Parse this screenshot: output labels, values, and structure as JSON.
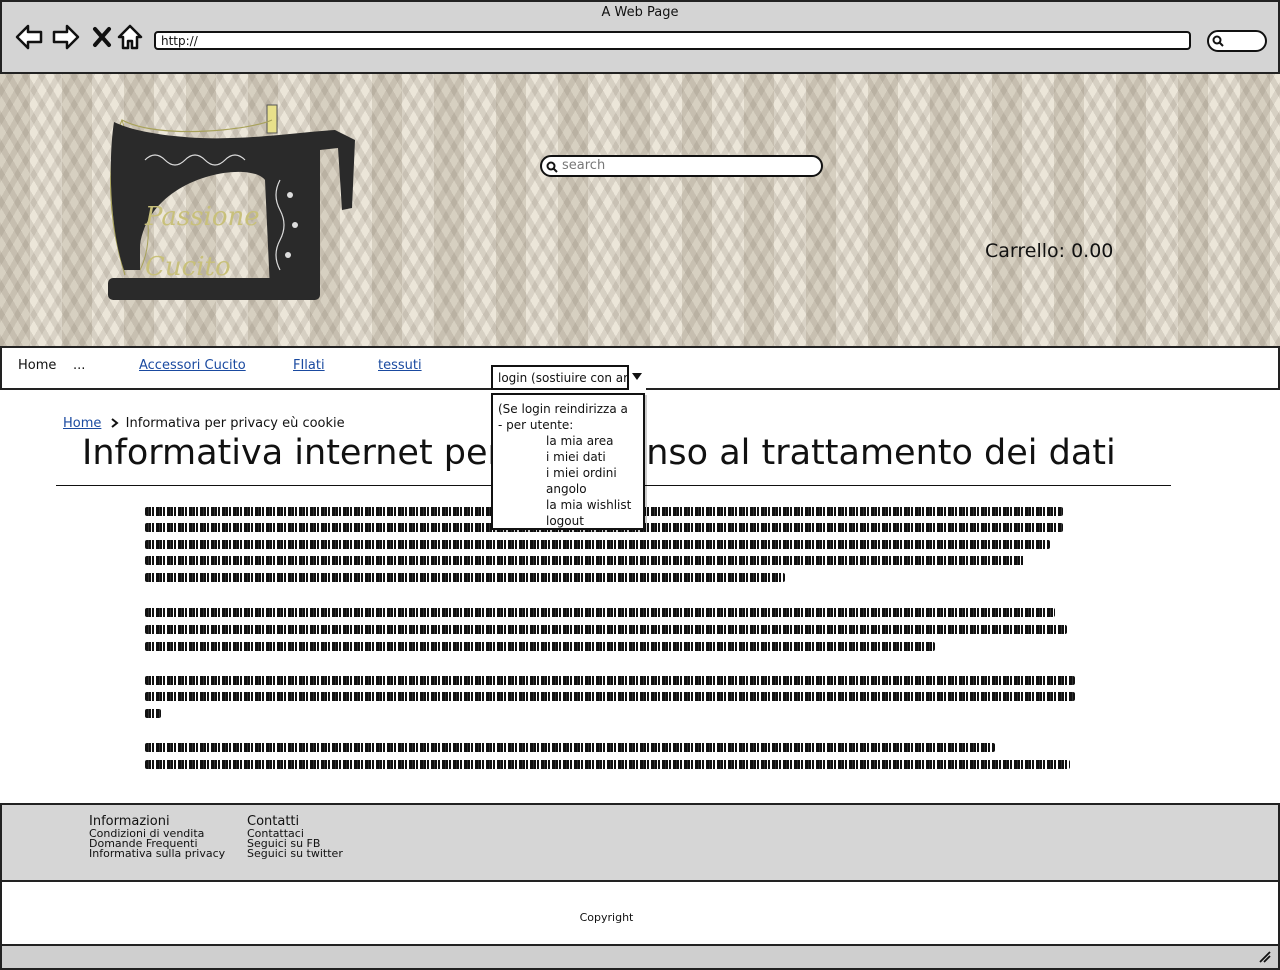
{
  "window": {
    "title": "A Web Page"
  },
  "browser": {
    "url": "http://"
  },
  "header": {
    "search_placeholder": "search",
    "cart_label": "Carrello: 0.00",
    "logo_text_1": "Passione",
    "logo_text_2": "Cucito"
  },
  "nav": {
    "home": "Home",
    "more": "...",
    "accessori": "Accessori Cucito",
    "filati": "FIlati",
    "tessuti": "tessuti",
    "login_select": "login (sostiuire con area"
  },
  "dropdown": {
    "line1": "(Se login reindirizza a",
    "line2": "- per utente:",
    "items": [
      "la mia area",
      "i miei dati",
      "i miei ordini",
      "angolo",
      "la mia wishlist",
      "logout"
    ]
  },
  "breadcrumb": {
    "home": "Home",
    "current": "Informativa per privacy eù cookie"
  },
  "page": {
    "title": "Informativa internet per il consenso al trattamento dei dati"
  },
  "footer": {
    "col1_title": "Informazioni",
    "col1_links": [
      "Condizioni di vendita",
      "Domande Frequenti",
      "Informativa sulla privacy"
    ],
    "col2_title": "Contatti",
    "col2_links": [
      "Contattaci",
      "Seguici su FB",
      "Seguici su twitter"
    ],
    "copyright": "Copyright"
  },
  "icons": [
    "back-arrow-icon",
    "forward-arrow-icon",
    "close-icon",
    "home-icon",
    "search-icon",
    "chevron-right-icon",
    "chevron-down-icon",
    "resize-grip-icon"
  ]
}
